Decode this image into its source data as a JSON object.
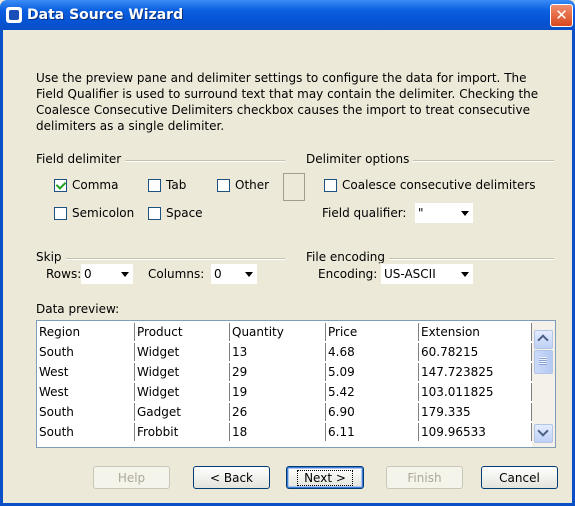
{
  "window": {
    "title": "Data Source Wizard",
    "close_glyph": "✕"
  },
  "intro_text": "Use the preview pane and delimiter settings to configure the data for import.  The Field Qualifier is used to surround text that may contain the delimiter.  Checking the Coalesce Consecutive Delimiters checkbox causes the import to treat consecutive delimiters as a single delimiter.",
  "field_delimiter": {
    "label": "Field delimiter",
    "comma": {
      "label": "Comma",
      "checked": true
    },
    "tab": {
      "label": "Tab",
      "checked": false
    },
    "other": {
      "label": "Other",
      "checked": false,
      "value": ""
    },
    "semicolon": {
      "label": "Semicolon",
      "checked": false
    },
    "space": {
      "label": "Space",
      "checked": false
    }
  },
  "delimiter_options": {
    "label": "Delimiter options",
    "coalesce": {
      "label": "Coalesce consecutive delimiters",
      "checked": false
    },
    "qualifier_label": "Field qualifier:",
    "qualifier_value": "\""
  },
  "skip": {
    "label": "Skip",
    "rows_label": "Rows:",
    "rows_value": "0",
    "columns_label": "Columns:",
    "columns_value": "0"
  },
  "file_encoding": {
    "label": "File encoding",
    "encoding_label": "Encoding:",
    "encoding_value": "US-ASCII"
  },
  "preview": {
    "label": "Data preview:",
    "rows": [
      [
        "Region",
        "Product",
        "Quantity",
        "Price",
        "Extension"
      ],
      [
        "South",
        "Widget",
        "13",
        "4.68",
        "60.78215"
      ],
      [
        "West",
        "Widget",
        "29",
        "5.09",
        "147.723825"
      ],
      [
        "West",
        "Widget",
        "19",
        "5.42",
        "103.011825"
      ],
      [
        "South",
        "Gadget",
        "26",
        "6.90",
        "179.335"
      ],
      [
        "South",
        "Frobbit",
        "18",
        "6.11",
        "109.96533"
      ]
    ]
  },
  "buttons": {
    "help": "Help",
    "back": "< Back",
    "next": "Next >",
    "finish": "Finish",
    "cancel": "Cancel"
  },
  "colors": {
    "titlebar": "#0654d4",
    "dialog_bg": "#ece9d8",
    "check_green": "#21a121"
  }
}
